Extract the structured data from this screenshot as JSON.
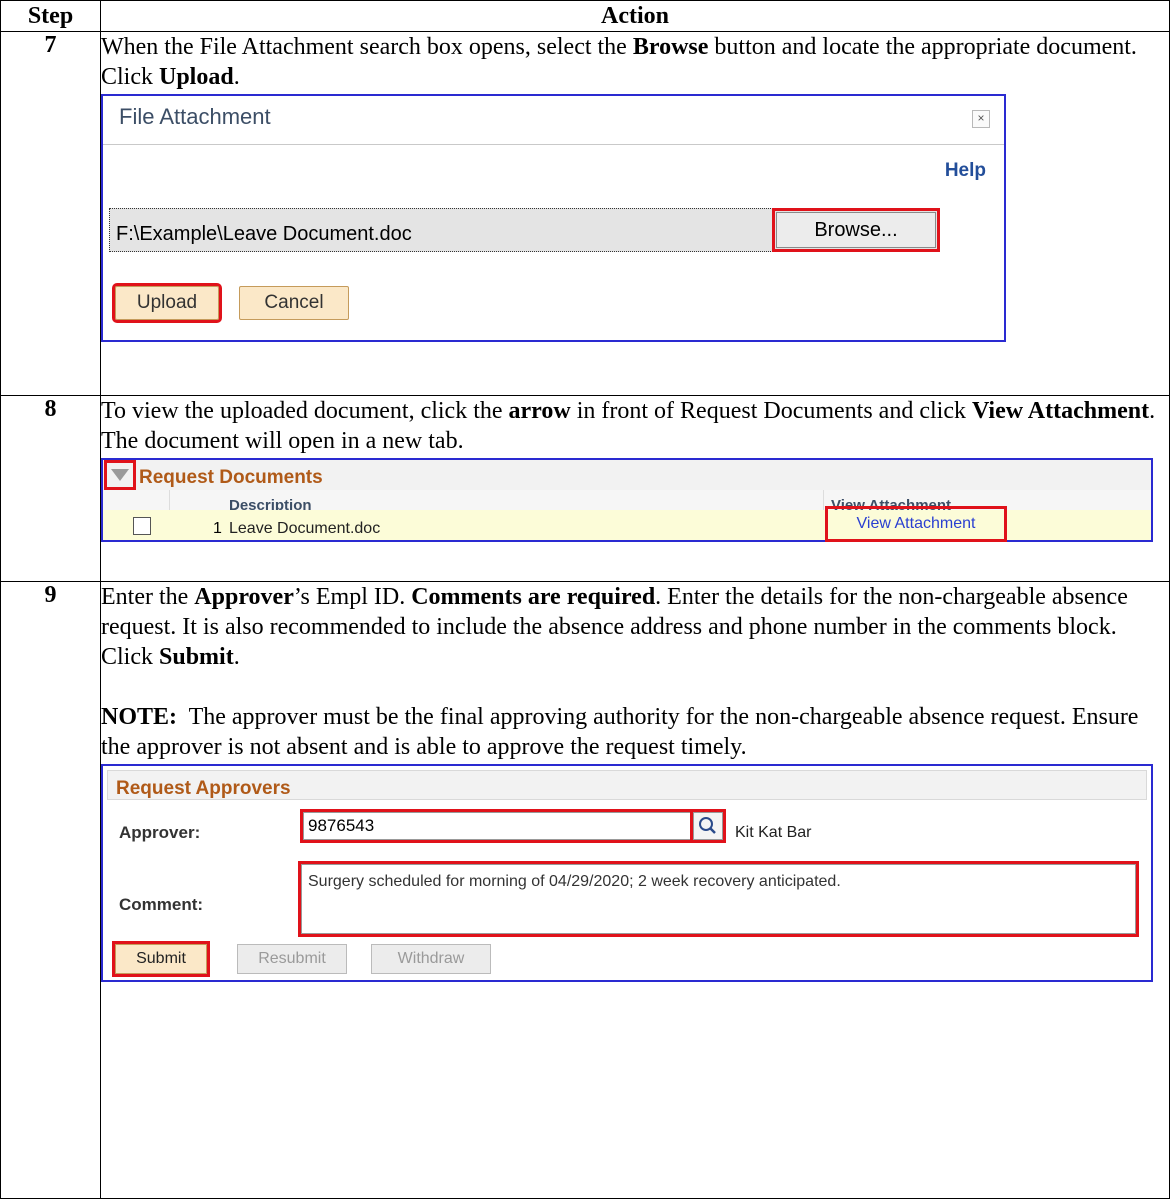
{
  "table": {
    "col_step": "Step",
    "col_action": "Action"
  },
  "steps": [
    {
      "num": "7",
      "text": {
        "p1": "When the File Attachment search box opens, select the ",
        "b1": "Browse",
        "p2": " button and locate the appropriate document. Click ",
        "b2": "Upload",
        "p3": "."
      }
    },
    {
      "num": "8",
      "text": {
        "p1": "To view the uploaded document, click the ",
        "b1": "arrow",
        "p2": " in front of Request Documents and click ",
        "b2": "View Attachment",
        "p3": ". The document will open in a new tab."
      }
    },
    {
      "num": "9",
      "text": {
        "p1": "Enter the ",
        "b1": "Approver",
        "p2": "’s Empl ID. ",
        "b2": "Comments are required",
        "p3": ". Enter the details for the non-chargeable absence request. It is also recommended to include the absence address and phone number in the comments block. Click ",
        "b3": "Submit",
        "p4": "."
      },
      "note_label": "NOTE:",
      "note_text": "  The approver must be the final approving authority for the non-chargeable absence request. Ensure the approver is not absent and is able to approve the request timely."
    }
  ],
  "file_attachment": {
    "title": "File Attachment",
    "close_glyph": "×",
    "help": "Help",
    "file_path": "F:\\Example\\Leave Document.doc",
    "browse_label": "Browse...",
    "upload_label": "Upload",
    "cancel_label": "Cancel"
  },
  "request_documents": {
    "title": "Request Documents",
    "col_description": "Description",
    "col_view": "View Attachment",
    "rows": [
      {
        "num": "1",
        "description": "Leave Document.doc",
        "link": "View Attachment"
      }
    ]
  },
  "request_approvers": {
    "title": "Request Approvers",
    "approver_label": "Approver:",
    "approver_value": "9876543",
    "approver_name": "Kit Kat Bar",
    "comment_label": "Comment:",
    "comment_value": "Surgery scheduled for morning of 04/29/2020; 2 week recovery anticipated.",
    "submit_label": "Submit",
    "resubmit_label": "Resubmit",
    "withdraw_label": "Withdraw"
  },
  "colors": {
    "highlight_box": "#e0121a",
    "screenshot_border": "#2a2ad1",
    "section_title": "#b05a18",
    "link": "#2a3fd1"
  }
}
